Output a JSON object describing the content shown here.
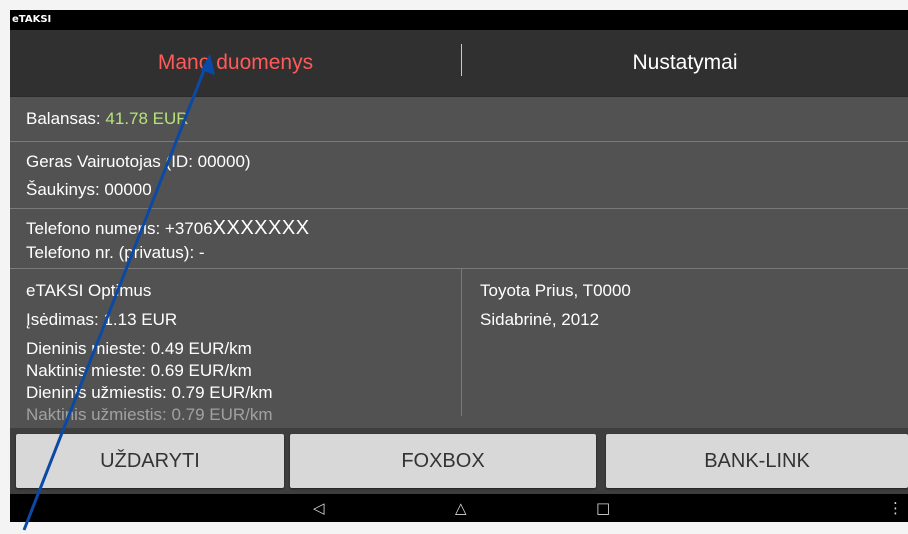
{
  "app": {
    "title": "eTAKSI"
  },
  "tabs": [
    {
      "label": "Mano duomenys",
      "active": true
    },
    {
      "label": "Nustatymai",
      "active": false
    }
  ],
  "balance": {
    "label": "Balansas:",
    "value": "41.78 EUR"
  },
  "driver": {
    "name_line": "Geras Vairuotojas (ID: 00000)",
    "callsign_line": "Šaukinys: 00000"
  },
  "phone": {
    "label": "Telefono numeris: +3706",
    "masked": "XXXXXXX",
    "private_line": "Telefono nr. (privatus): -"
  },
  "tariff": {
    "lines": [
      "eTAKSI Optimus",
      "Įsėdimas: 1.13 EUR",
      "Dieninis mieste: 0.49 EUR/km",
      "Naktinis mieste: 0.69 EUR/km",
      "Dieninis užmiestis: 0.79 EUR/km",
      "Naktinis užmiestis: 0.79 EUR/km"
    ]
  },
  "car": {
    "lines": [
      "Toyota Prius, T0000",
      "Sidabrinė, 2012"
    ]
  },
  "buttons": {
    "close": "UŽDARYTI",
    "foxbox": "FOXBOX",
    "banklink": "BANK-LINK"
  },
  "nav": {
    "back": "◁",
    "home": "△",
    "recents": "□",
    "menu": "⋮"
  },
  "colors": {
    "accent_tab": "#ff5a5a",
    "balance_value": "#b7e37a",
    "annotation_arrow": "#0a4aa6"
  }
}
